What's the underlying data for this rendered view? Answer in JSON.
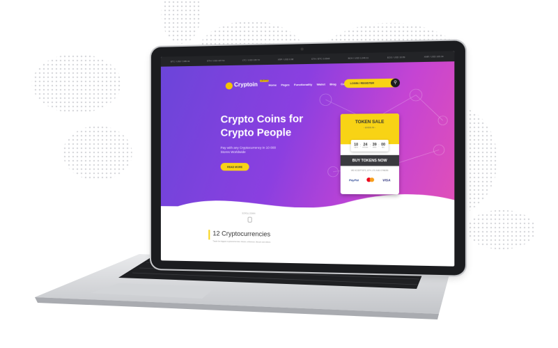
{
  "ticker": [
    "BTC / USD  7,985.03",
    "ETH / USD  437.51",
    "LTC / USD  135.72",
    "XRP / USD  0.68",
    "ETH / BTC  0.0548",
    "BCH / USD  1,046.11",
    "EOS / USD  10.89",
    "XMR / USD  165.34"
  ],
  "nav": {
    "logo": "Cryptoin",
    "logo_badge": "CRYPTO",
    "items": [
      "Home",
      "Pages",
      "Functionality",
      "Wallet",
      "Blog",
      "Contact"
    ],
    "login": "LOGIN / REGISTER"
  },
  "hero": {
    "headline": "Crypto Coins for Crypto People",
    "subline": "Pay with any Cryptocurrency in 10 000 Stores Worldwide",
    "cta": "READ MORE"
  },
  "token_card": {
    "title": "TOKEN SALE",
    "subtitle": "- ENDS IN -",
    "countdown": [
      {
        "value": "10",
        "label": "DAYS"
      },
      {
        "value": "24",
        "label": "HOURS"
      },
      {
        "value": "39",
        "label": "MINS"
      },
      {
        "value": "00",
        "label": "SEC"
      }
    ],
    "buy_label": "BUY TOKENS NOW",
    "accept_text": "WE ACCEPT BTC, ETH, LTC AND OTHERS",
    "payments": {
      "paypal": "PayPal",
      "visa": "VISA"
    }
  },
  "scroll_label": "SCROLL DOWN",
  "section": {
    "title": "12 Cryptocurrencies",
    "desc": "Trade the biggest cryptocurrencies: bitcoin, ethereum, litecoin and others"
  },
  "colors": {
    "accent_yellow": "#f8d315",
    "hero_start": "#6b45d9",
    "hero_end": "#e04fb8",
    "dark": "#1b1c1f"
  }
}
